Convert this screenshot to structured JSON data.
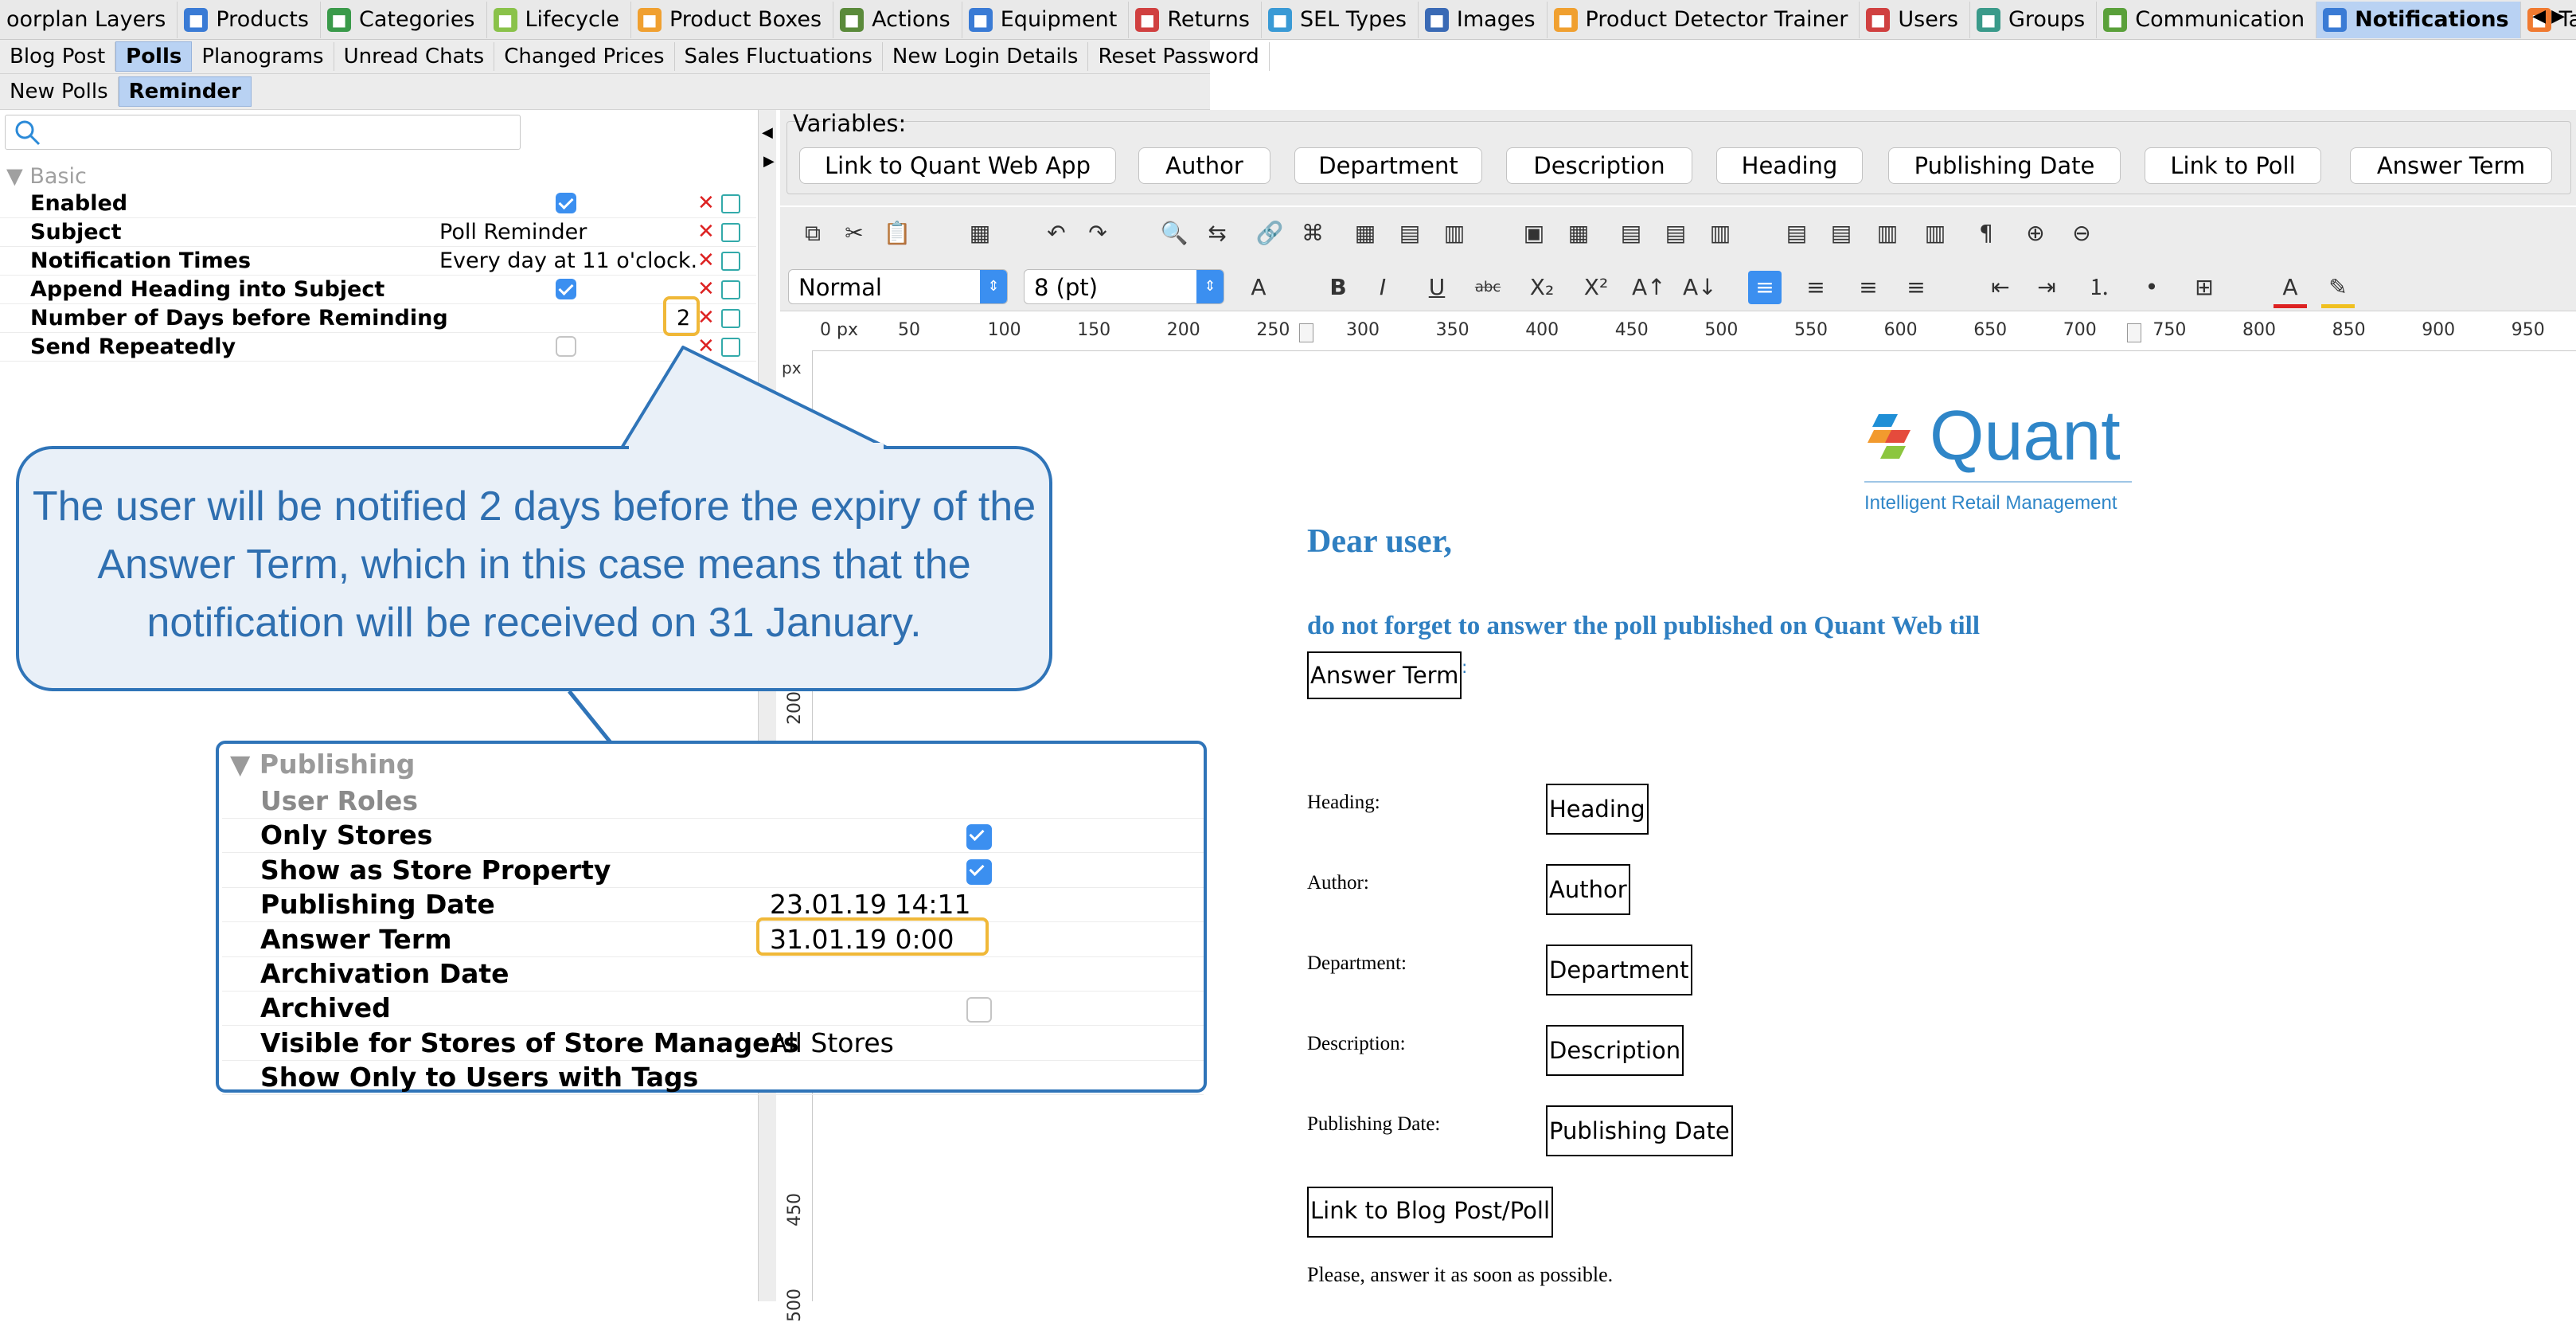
{
  "top_tabs": [
    {
      "label": "oorplan Layers",
      "icon": "floorplan-icon",
      "color": "#ffffff"
    },
    {
      "label": "Products",
      "icon": "products-icon",
      "color": "#3a7bd5"
    },
    {
      "label": "Categories",
      "icon": "categories-icon",
      "color": "#3a9a4a"
    },
    {
      "label": "Lifecycle",
      "icon": "lifecycle-icon",
      "color": "#8ac24a"
    },
    {
      "label": "Product Boxes",
      "icon": "product-boxes-icon",
      "color": "#f0a030"
    },
    {
      "label": "Actions",
      "icon": "actions-icon",
      "color": "#5a8a3a"
    },
    {
      "label": "Equipment",
      "icon": "equipment-icon",
      "color": "#3a7bd5"
    },
    {
      "label": "Returns",
      "icon": "returns-icon",
      "color": "#d04040"
    },
    {
      "label": "SEL Types",
      "icon": "sel-types-icon",
      "color": "#3a9ad5"
    },
    {
      "label": "Images",
      "icon": "images-icon",
      "color": "#3a6ab5"
    },
    {
      "label": "Product Detector Trainer",
      "icon": "trainer-icon",
      "color": "#f0a030"
    },
    {
      "label": "Users",
      "icon": "users-icon",
      "color": "#d04040"
    },
    {
      "label": "Groups",
      "icon": "groups-icon",
      "color": "#3a9a8a"
    },
    {
      "label": "Communication",
      "icon": "communication-icon",
      "color": "#5aa03a"
    },
    {
      "label": "Notifications",
      "icon": "notifications-icon",
      "color": "#3a7bd5"
    },
    {
      "label": "Tasks",
      "icon": "tasks-icon",
      "color": "#f07a30"
    }
  ],
  "second_tabs": [
    "Blog Post",
    "Polls",
    "Planograms",
    "Unread Chats",
    "Changed Prices",
    "Sales Fluctuations",
    "New Login Details",
    "Reset Password"
  ],
  "third_tabs": [
    "New Polls",
    "Reminder"
  ],
  "basic": {
    "section_title": "Basic",
    "rows": [
      {
        "label": "Enabled",
        "value": "",
        "checked": true
      },
      {
        "label": "Subject",
        "value": "Poll Reminder"
      },
      {
        "label": "Notification Times",
        "value": "Every day at 11 o'clock."
      },
      {
        "label": "Append Heading into Subject",
        "value": "",
        "checked": true
      },
      {
        "label": "Number of Days before Reminding",
        "value": "2"
      },
      {
        "label": "Send Repeatedly",
        "value": "",
        "checked": false
      }
    ]
  },
  "variables": {
    "title": "Variables:",
    "buttons": [
      "Link to Quant Web App",
      "Author",
      "Department",
      "Description",
      "Heading",
      "Publishing Date",
      "Link to Poll",
      "Answer Term"
    ]
  },
  "editor": {
    "style_select": "Normal",
    "size_select": "8 (pt)",
    "ruler_px": "0 px",
    "ruler_marks": [
      "50",
      "100",
      "150",
      "200",
      "250",
      "300",
      "350",
      "400",
      "450",
      "500",
      "550",
      "600",
      "650",
      "700",
      "750",
      "800",
      "850",
      "900",
      "950"
    ],
    "vruler_unit": "px",
    "vruler_marks": [
      "200",
      "450",
      "500"
    ]
  },
  "document": {
    "logo_text": "Quant",
    "logo_tagline": "Intelligent Retail Management",
    "greeting": "Dear user,",
    "line1": "do not forget to answer the poll published on Quant Web till",
    "answer_term_field": "Answer Term",
    "fields": [
      {
        "label": "Heading:",
        "value": "Heading"
      },
      {
        "label": "Author:",
        "value": "Author"
      },
      {
        "label": "Department:",
        "value": "Department"
      },
      {
        "label": "Description:",
        "value": "Description"
      },
      {
        "label": "Publishing Date:",
        "value": "Publishing Date"
      }
    ],
    "link_field": "Link to Blog Post/Poll",
    "closing": "Please, answer it as soon as possible.",
    "accent": "#2f7fc1"
  },
  "callout": {
    "text": "The user will be notified 2 days before the expiry of the Answer Term, which in this case means that the notification will be received on 31 January."
  },
  "publishing": {
    "section_title": "Publishing",
    "rows": [
      {
        "label": "User Roles",
        "value": "",
        "muted": true
      },
      {
        "label": "Only Stores",
        "value": "",
        "checked": true
      },
      {
        "label": "Show as Store Property",
        "value": "",
        "checked": true
      },
      {
        "label": "Publishing Date",
        "value": "23.01.19 14:11"
      },
      {
        "label": "Answer Term",
        "value": "31.01.19 0:00"
      },
      {
        "label": "Archivation Date",
        "value": ""
      },
      {
        "label": "Archived",
        "value": "",
        "checked": false
      },
      {
        "label": "Visible for Stores of Store Managers",
        "value": "All Stores"
      },
      {
        "label": "Show Only to Users with Tags",
        "value": ""
      }
    ]
  },
  "colors": {
    "highlight": "#f0b838",
    "callout_blue": "#2f74b8",
    "active_tab": "#b9d2f3"
  }
}
